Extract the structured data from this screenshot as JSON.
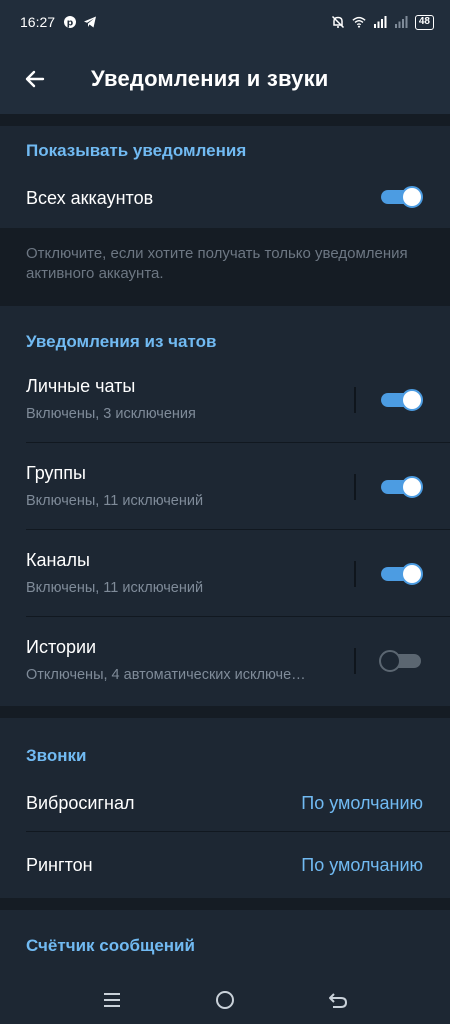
{
  "status_bar": {
    "time": "16:27",
    "battery": "48"
  },
  "header": {
    "title": "Уведомления и звуки"
  },
  "show_notifications": {
    "header": "Показывать уведомления",
    "all_accounts_label": "Всех аккаунтов",
    "all_accounts_on": true,
    "info": "Отключите, если хотите получать только уведомления активного аккаунта."
  },
  "chat_notifications": {
    "header": "Уведомления из чатов",
    "items": [
      {
        "title": "Личные чаты",
        "subtitle": "Включены, 3 исключения",
        "enabled": true
      },
      {
        "title": "Группы",
        "subtitle": "Включены, 11 исключений",
        "enabled": true
      },
      {
        "title": "Каналы",
        "subtitle": "Включены, 11 исключений",
        "enabled": true
      },
      {
        "title": "Истории",
        "subtitle": "Отключены, 4 автоматических исключе…",
        "enabled": false
      }
    ]
  },
  "calls": {
    "header": "Звонки",
    "vibrate_label": "Вибросигнал",
    "vibrate_value": "По умолчанию",
    "ringtone_label": "Рингтон",
    "ringtone_value": "По умолчанию"
  },
  "badge_counter": {
    "header": "Счётчик сообщений"
  },
  "colors": {
    "accent": "#71baf2",
    "toggle_on": "#4c9ce2",
    "background": "#151c24",
    "section": "#1d2733",
    "header_bar": "#212d3b"
  }
}
